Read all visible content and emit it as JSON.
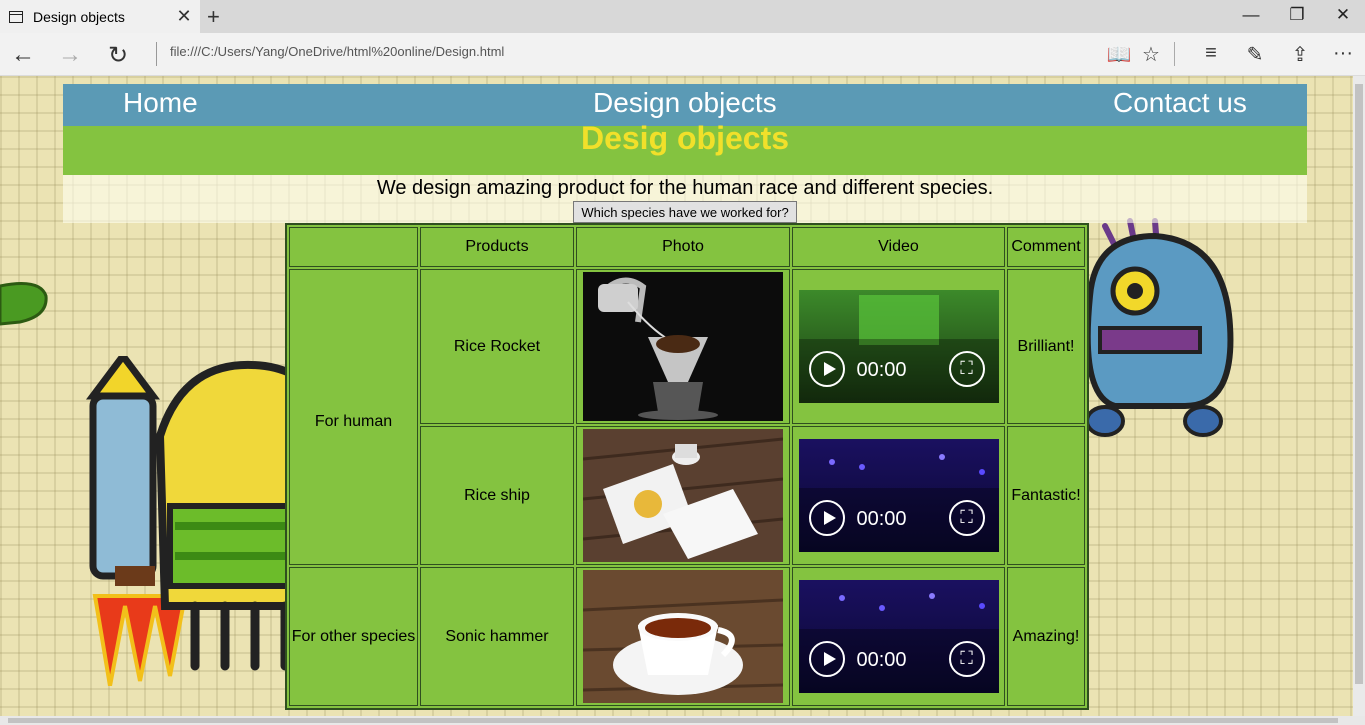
{
  "browser": {
    "tab_title": "Design objects",
    "tab_close": "✕",
    "new_tab": "+",
    "address": "file:///C:/Users/Yang/OneDrive/html%20online/Design.html",
    "window_controls": {
      "minimize": "—",
      "restore": "❐",
      "close": "✕"
    },
    "nav": {
      "back": "←",
      "forward": "→",
      "refresh": "↻"
    },
    "tools": {
      "reading_view": "📖",
      "favorite": "☆",
      "hub": "≡",
      "web_note": "✎",
      "share": "⇪",
      "more": "···"
    }
  },
  "nav": {
    "home": "Home",
    "design_objects": "Design objects",
    "contact_us": "Contact us"
  },
  "banner": {
    "title": "Desig objects"
  },
  "intro": {
    "text": "We design amazing product for the human race and different species.",
    "button": "Which species have we worked for?"
  },
  "table": {
    "headers": [
      "",
      "Products",
      "Photo",
      "Video",
      "Comment"
    ],
    "groups": [
      "For human",
      "For other species"
    ],
    "rows": [
      {
        "product": "Rice Rocket",
        "photo": "coffee-dripper-photo",
        "video_time": "00:00",
        "comment": "Brilliant!"
      },
      {
        "product": "Rice ship",
        "photo": "coffee-bags-photo",
        "video_time": "00:00",
        "comment": "Fantastic!"
      },
      {
        "product": "Sonic hammer",
        "photo": "tea-cup-photo",
        "video_time": "00:00",
        "comment": "Amazing!"
      }
    ]
  },
  "colors": {
    "nav_bg": "#5b9ab5",
    "banner_bg": "#84c340",
    "banner_title": "#f1e02a",
    "page_bg": "#ebe3b3"
  }
}
